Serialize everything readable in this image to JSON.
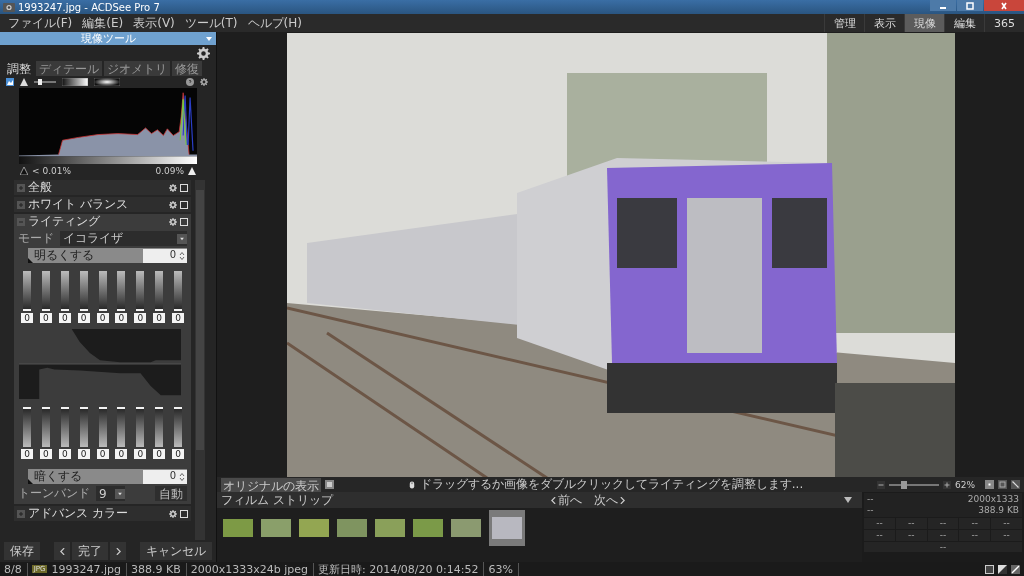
{
  "window": {
    "title": "1993247.jpg - ACDSee Pro 7"
  },
  "menu": [
    "ファイル(F)",
    "編集(E)",
    "表示(V)",
    "ツール(T)",
    "ヘルプ(H)"
  ],
  "modes": [
    {
      "label": "管理",
      "selected": false
    },
    {
      "label": "表示",
      "selected": false
    },
    {
      "label": "現像",
      "selected": true
    },
    {
      "label": "編集",
      "selected": false
    },
    {
      "label": "365",
      "selected": false
    }
  ],
  "panel": {
    "title": "現像ツール",
    "tabs": [
      {
        "label": "調整",
        "selected": true
      },
      {
        "label": "ディテール",
        "selected": false
      },
      {
        "label": "ジオメトリ",
        "selected": false
      },
      {
        "label": "修復",
        "selected": false
      }
    ],
    "clip_low": "< 0.01%",
    "clip_high": "0.09%",
    "sections": [
      {
        "label": "全般",
        "expanded": false
      },
      {
        "label": "ホワイト バランス",
        "expanded": false
      },
      {
        "label": "ライティング",
        "expanded": true
      },
      {
        "label": "アドバンス カラー",
        "expanded": false
      }
    ],
    "lighting": {
      "mode_label": "モード",
      "mode_value": "イコライザ",
      "brighten": {
        "label": "明るくする",
        "value": "0",
        "level": 0
      },
      "upper_bands": [
        {
          "value": "0",
          "level": 0
        },
        {
          "value": "0",
          "level": 0
        },
        {
          "value": "0",
          "level": 0
        },
        {
          "value": "0",
          "level": 0
        },
        {
          "value": "0",
          "level": 0
        },
        {
          "value": "0",
          "level": 0
        },
        {
          "value": "0",
          "level": 0
        },
        {
          "value": "0",
          "level": 0
        },
        {
          "value": "0",
          "level": 0
        }
      ],
      "lower_bands": [
        {
          "value": "0",
          "level": 0
        },
        {
          "value": "0",
          "level": 0
        },
        {
          "value": "0",
          "level": 0
        },
        {
          "value": "0",
          "level": 0
        },
        {
          "value": "0",
          "level": 0
        },
        {
          "value": "0",
          "level": 0
        },
        {
          "value": "0",
          "level": 0
        },
        {
          "value": "0",
          "level": 0
        },
        {
          "value": "0",
          "level": 0
        }
      ],
      "darken": {
        "label": "暗くする",
        "value": "0",
        "level": 0
      },
      "tone_band_label": "トーンバンド",
      "tone_band_value": "9",
      "auto_button": "自動"
    },
    "buttons": {
      "save": "保存",
      "done": "完了",
      "cancel": "キャンセル"
    }
  },
  "viewer": {
    "show_original": "オリジナルの表示",
    "hint": "ドラッグするか画像をダブルクリックしてライティングを調整します...",
    "zoom_slider": {
      "level": 0.3
    },
    "zoom": "62%"
  },
  "filmstrip": {
    "title": "フィルム ストリップ",
    "prev": "前へ",
    "next": "次へ",
    "thumbnails": [
      {
        "selected": false
      },
      {
        "selected": false
      },
      {
        "selected": false
      },
      {
        "selected": false
      },
      {
        "selected": false
      },
      {
        "selected": false
      },
      {
        "selected": false
      },
      {
        "selected": true
      }
    ]
  },
  "info": {
    "rows": [
      {
        "left": "--",
        "right": "2000x1333"
      },
      {
        "left": "--",
        "right": "388.9 KB"
      }
    ],
    "grid": [
      "--",
      "--",
      "--",
      "--",
      "--",
      "--",
      "--",
      "--",
      "--",
      "--"
    ],
    "footer": "--"
  },
  "status_bar": {
    "count": "8/8",
    "file_type": "JPG",
    "file_name": "1993247.jpg",
    "size": "388.9 KB",
    "format": "2000x1333x24b jpeg",
    "modified": "更新日時: 2014/08/20 0:14:52",
    "zoom": "63%"
  }
}
